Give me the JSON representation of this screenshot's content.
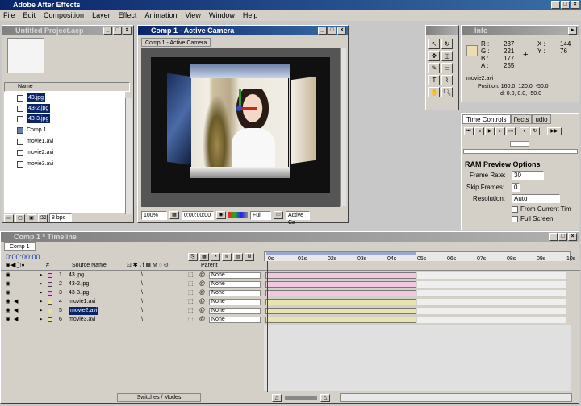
{
  "app": {
    "title": "Adobe After Effects"
  },
  "menu": [
    "File",
    "Edit",
    "Composition",
    "Layer",
    "Effect",
    "Animation",
    "View",
    "Window",
    "Help"
  ],
  "project": {
    "title": "Untitled Project.aep",
    "column_name": "Name",
    "items": [
      {
        "label": "43.jpg",
        "type": "image"
      },
      {
        "label": "43-2.jpg",
        "type": "image"
      },
      {
        "label": "43-3.jpg",
        "type": "image"
      },
      {
        "label": "Comp 1",
        "type": "comp"
      },
      {
        "label": "movie1.avi",
        "type": "movie"
      },
      {
        "label": "movie2.avi",
        "type": "movie"
      },
      {
        "label": "movie3.avi",
        "type": "movie"
      }
    ],
    "bpc": "8 bpc"
  },
  "comp_window": {
    "title": "Comp 1 - Active Camera",
    "tab": "Comp 1 - Active Camera",
    "zoom": "100%",
    "timecode": "0:00:00:00",
    "resolution": "Full",
    "camera": "Active Ca"
  },
  "info": {
    "title": "Info",
    "r_label": "R :",
    "r": "237",
    "g_label": "G :",
    "g": "221",
    "b_label": "B :",
    "b": "177",
    "a_label": "A :",
    "a": "255",
    "x_label": "X :",
    "x": "144",
    "y_label": "Y :",
    "y": "76",
    "swatch_color": "#edddb1",
    "file": "movie2.avi",
    "position": "Position: 160.0, 120.0, -50.0",
    "delta": "d: 0.0, 0.0, -50.0"
  },
  "time_controls": {
    "tab1": "Time Controls",
    "tab2": "ffects",
    "tab3": "udio",
    "ram_preview_title": "RAM Preview Options",
    "frame_rate_label": "Frame Rate:",
    "frame_rate": "30",
    "skip_frames_label": "Skip Frames:",
    "skip_frames": "0",
    "resolution_label": "Resolution:",
    "resolution": "Auto",
    "from_current_time": "From Current Tim",
    "full_screen": "Full Screen"
  },
  "timeline": {
    "title": "Comp 1 * Timeline",
    "tab": "Comp 1",
    "timecode": "0:00:00:00",
    "col_source_name": "Source Name",
    "col_parent": "Parent",
    "ruler": [
      "0s",
      "01s",
      "02s",
      "03s",
      "04s",
      "05s",
      "06s",
      "07s",
      "08s",
      "09s",
      "10s"
    ],
    "layers": [
      {
        "num": "1",
        "name": "43.jpg",
        "color": "#e7b3d6",
        "bar_color": "#f0c8e0",
        "parent": "None"
      },
      {
        "num": "2",
        "name": "43-2.jpg",
        "color": "#e7b3d6",
        "bar_color": "#f0c8e0",
        "parent": "None"
      },
      {
        "num": "3",
        "name": "43-3.jpg",
        "color": "#e7b3d6",
        "bar_color": "#f0c8e0",
        "parent": "None"
      },
      {
        "num": "4",
        "name": "movie1.avi",
        "color": "#e8e0a0",
        "bar_color": "#e8e4b0",
        "parent": "None"
      },
      {
        "num": "5",
        "name": "movie2.avi",
        "color": "#e8e0a0",
        "bar_color": "#e8e4b0",
        "parent": "None"
      },
      {
        "num": "6",
        "name": "movie3.avi",
        "color": "#e8e0a0",
        "bar_color": "#e8e4b0",
        "parent": "None"
      }
    ],
    "switches_modes": "Switches / Modes"
  }
}
